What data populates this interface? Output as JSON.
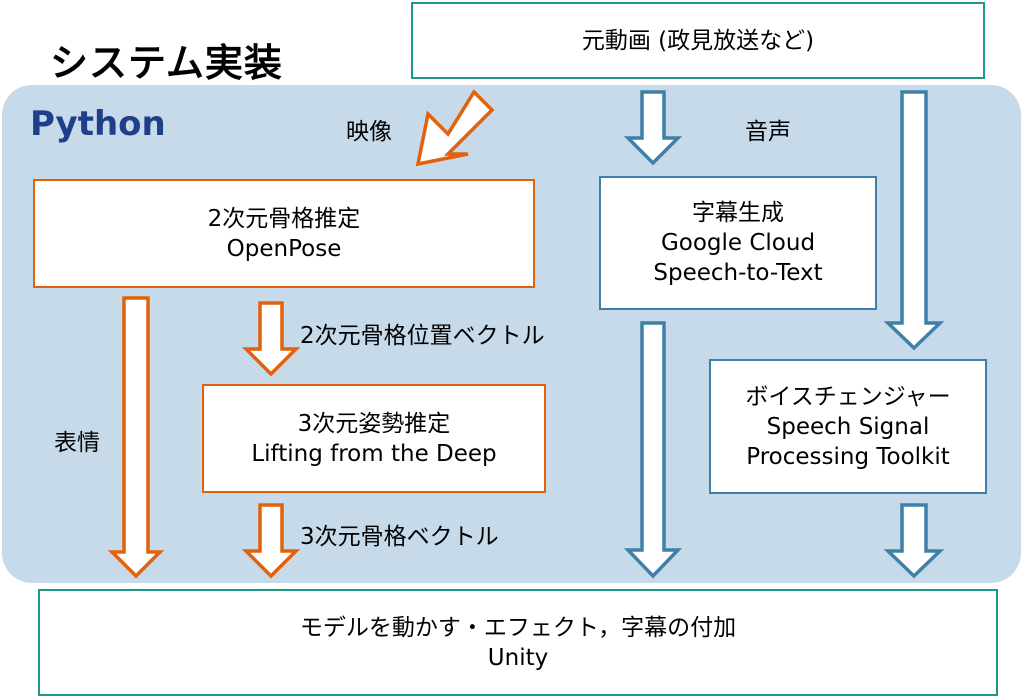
{
  "header": {
    "system_title": "システム実装",
    "python_label": "Python"
  },
  "nodes": {
    "source_video": {
      "line1": "元動画 (政見放送など)"
    },
    "pose2d": {
      "line1": "2次元骨格推定",
      "line2": "OpenPose"
    },
    "pose3d": {
      "line1": "3次元姿勢推定",
      "line2": "Lifting from the Deep"
    },
    "subtitle_gen": {
      "line1": "字幕生成",
      "line2": "Google Cloud",
      "line3": "Speech-to-Text"
    },
    "voice_changer": {
      "line1": "ボイスチェンジャー",
      "line2": "Speech Signal",
      "line3": "Processing Toolkit"
    },
    "unity": {
      "line1": "モデルを動かす・エフェクト，字幕の付加",
      "line2": "Unity"
    }
  },
  "edge_labels": {
    "video": "映像",
    "audio": "音声",
    "vec2d": "2次元骨格位置ベクトル",
    "vec3d": "3次元骨格ベクトル",
    "expression": "表情"
  },
  "colors": {
    "orange": "#e2620c",
    "blue": "#3f80a8",
    "teal": "#1d9a86",
    "python_bg": "#c6dae9",
    "python_text": "#1f3f8a"
  }
}
